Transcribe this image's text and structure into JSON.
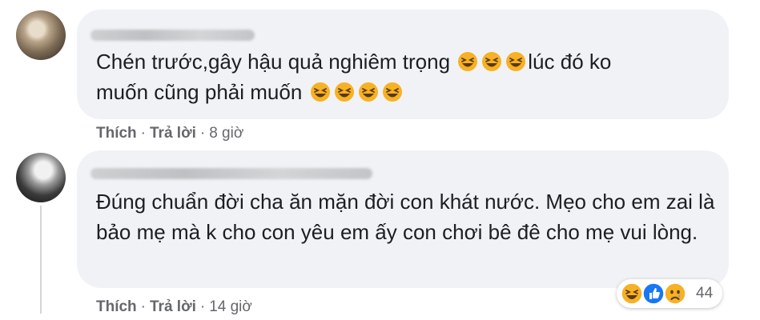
{
  "comments": [
    {
      "text": "Chén trước,gây hậu quả nghiêm trọng 😆😆😆lúc đó ko muốn cũng phải muốn 😆😆😆😆",
      "line1_prefix": "Chén trước,gây hậu quả nghiêm trọng ",
      "line1_suffix": "lúc đó ko",
      "line2_prefix": "muốn cũng phải muốn ",
      "like_label": "Thích",
      "reply_label": "Trả lời",
      "time": "8 giờ"
    },
    {
      "text": "Đúng chuẩn đời cha ăn mặn đời con khát nước. Mẹo cho em zai là bảo mẹ mà k cho con yêu em ấy con chơi bê đê cho mẹ vui lòng.",
      "like_label": "Thích",
      "reply_label": "Trả lời",
      "time": "14 giờ",
      "reaction_count": "44",
      "reaction_icons": [
        "haha-icon",
        "like-icon",
        "sad-icon"
      ]
    }
  ],
  "separator": "·",
  "colors": {
    "bubble": "#f0f2f5",
    "text": "#1c1e21",
    "meta": "#65676b",
    "emoji_yellow": "#f7b125",
    "like_blue": "#1877f2"
  }
}
